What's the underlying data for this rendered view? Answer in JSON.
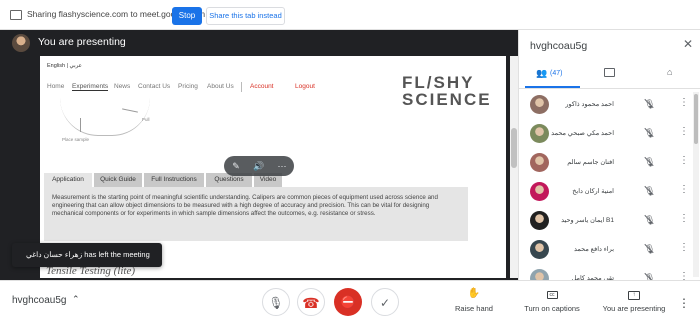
{
  "share_bar": {
    "message": "Sharing flashyscience.com to meet.google.com",
    "stop_label": "Stop",
    "share_tab_label": "Share this tab instead"
  },
  "presenting": {
    "label": "You are presenting"
  },
  "site": {
    "language": "English | عربي",
    "nav": [
      "Home",
      "Experiments",
      "News",
      "Contact Us",
      "Pricing",
      "About Us",
      "Account",
      "Logout"
    ],
    "logo_line1": "FL/SHY",
    "logo_line2": "SCIENCE",
    "diagram_pull": "Pull",
    "diagram_place": "Place sample",
    "tabs": [
      "Application",
      "Quick Guide",
      "Full Instructions",
      "Questions",
      "Video"
    ],
    "body_text": "Measurement is the starting point of meaningful scientific understanding. Calipers are common pieces of equipment used across science and engineering that can allow object dimensions to be measured with a high degree of accuracy and precision. This can be vital for designing mechanical components or for experiments in which sample dimensions affect the outcomes, e.g. resistance or stress.",
    "next_heading": "Tensile Testing (lite)"
  },
  "toast": {
    "message": "زهراء حسان داغي has left the meeting"
  },
  "panel": {
    "meeting_code": "hvghcoau5g",
    "people_count": "(47)",
    "participants": [
      {
        "name": "احمد محمود ذاكور",
        "color": "#8d6e63"
      },
      {
        "name": "احمد مكي صبحي محمد",
        "color": "#7b8a5c"
      },
      {
        "name": "افنان جاسم سالم",
        "color": "#a1665e"
      },
      {
        "name": "امنية اركان دابخ",
        "color": "#c2185b"
      },
      {
        "name": "ايمان ياسر وحيد B1",
        "color": "#212121"
      },
      {
        "name": "براء دافع محمد",
        "color": "#37474f"
      },
      {
        "name": "تقى محمد كامل",
        "color": "#90a4ae"
      }
    ]
  },
  "bottom": {
    "meeting_code": "hvghcoau5g",
    "raise_hand": "Raise hand",
    "captions": "Turn on captions",
    "presenting": "You are presenting"
  },
  "icons": {
    "share": "screen-share-icon",
    "close": "close-icon",
    "people": "people-icon",
    "chat": "chat-icon",
    "activities": "activities-icon",
    "mic_off": "mic-off-icon",
    "more": "more-vert-icon",
    "hangup": "call-end-icon",
    "camera_off": "videocam-off-icon",
    "hand": "hand-icon"
  },
  "colors": {
    "accent": "#1a73e8",
    "danger": "#d93025",
    "stage_bg": "#202124"
  }
}
